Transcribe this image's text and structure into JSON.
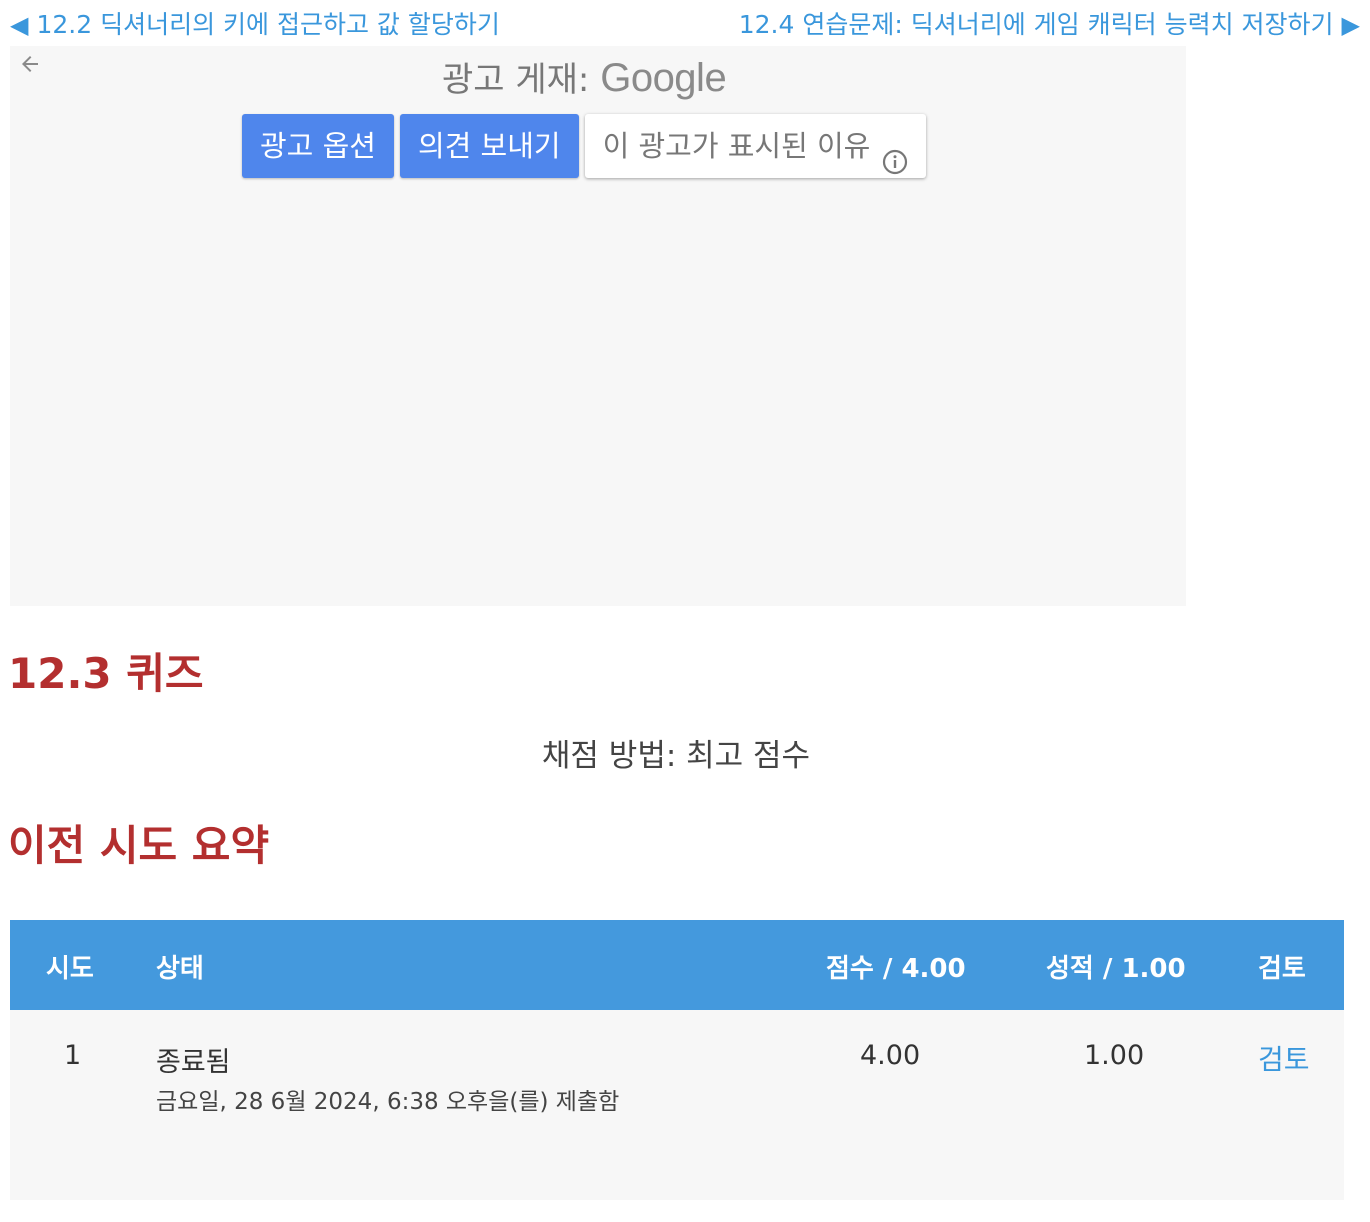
{
  "nav": {
    "prev_arrow": "◀",
    "prev_label": "12.2 딕셔너리의 키에 접근하고 값 할당하기",
    "next_label": "12.4 연습문제: 딕셔너리에 게임 캐릭터 능력치 저장하기",
    "next_arrow": "▶"
  },
  "ad": {
    "label": "광고 게재:",
    "brand": "Google",
    "back_icon": "back-arrow-icon",
    "options_button": "광고 옵션",
    "feedback_button": "의견 보내기",
    "why_button": "이 광고가 표시된 이유",
    "info_icon": "info-icon"
  },
  "quiz": {
    "title": "12.3 퀴즈",
    "grading": "채점 방법: 최고 점수"
  },
  "summary": {
    "title": "이전 시도 요약",
    "headers": {
      "attempt": "시도",
      "state": "상태",
      "score": "점수 / 4.00",
      "grade": "성적 / 1.00",
      "review": "검토"
    },
    "rows": [
      {
        "attempt": "1",
        "state": "종료됨",
        "submitted": "금요일, 28 6월 2024, 6:38 오후을(를) 제출함",
        "score": "4.00",
        "grade": "1.00",
        "review": "검토"
      }
    ]
  },
  "colors": {
    "link": "#3a97dc",
    "heading": "#b32f2f",
    "table_header": "#4499dd",
    "ad_button": "#4f86ec"
  }
}
